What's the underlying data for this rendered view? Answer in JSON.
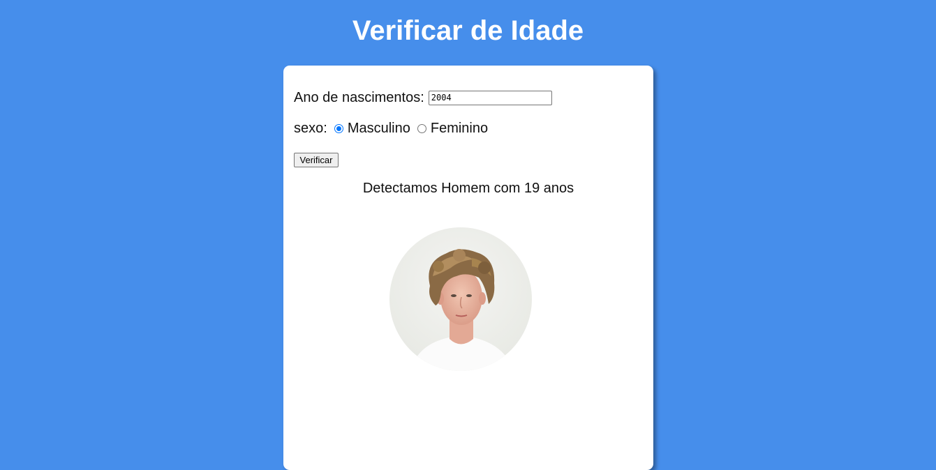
{
  "header": {
    "title": "Verificar de Idade"
  },
  "form": {
    "birth_year_label": "Ano de nascimentos:",
    "birth_year_value": "2004",
    "sex_label": "sexo:",
    "sex_options": [
      {
        "label": "Masculino",
        "checked": true
      },
      {
        "label": "Feminino",
        "checked": false
      }
    ],
    "verify_button_label": "Verificar"
  },
  "result": {
    "text": "Detectamos Homem com 19 anos",
    "photo_icon": "person-photo"
  },
  "colors": {
    "background": "#468eeb",
    "card": "#ffffff",
    "radio_accent": "#0075ff"
  }
}
